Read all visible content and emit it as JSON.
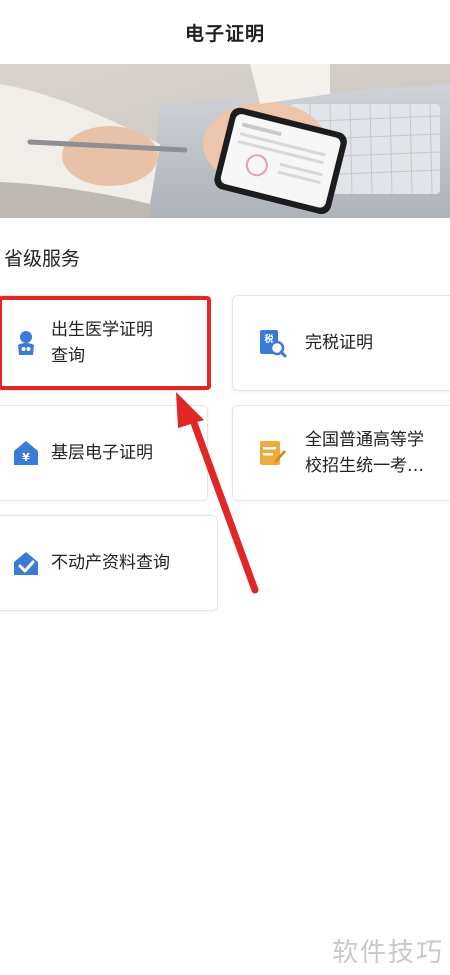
{
  "header": {
    "title": "电子证明"
  },
  "section": {
    "title": "省级服务"
  },
  "services": [
    {
      "label": "出生医学证明\n查询",
      "icon": "baby-icon"
    },
    {
      "label": "完税证明",
      "icon": "tax-certificate-icon"
    },
    {
      "label": "基层电子证明",
      "icon": "grassroots-certificate-icon"
    },
    {
      "label": "全国普通高等学\n校招生统一考…",
      "icon": "exam-edit-icon"
    },
    {
      "label": "不动产资料查询",
      "icon": "real-estate-check-icon"
    }
  ],
  "watermark": "软件技巧",
  "colors": {
    "accent": "#3a7bd5",
    "highlight": "#e12626"
  }
}
